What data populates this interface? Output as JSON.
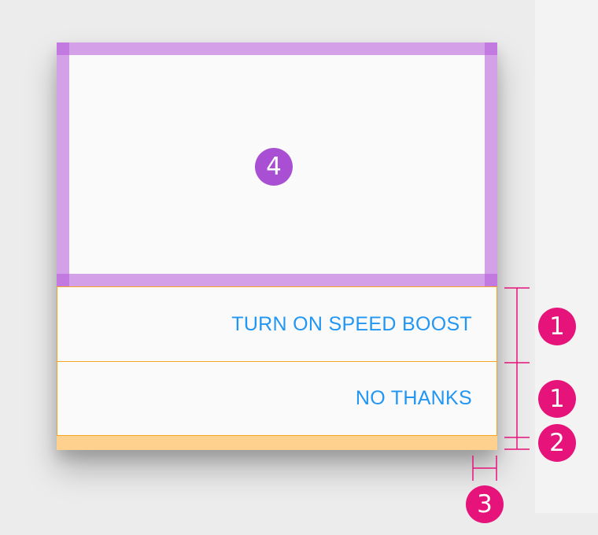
{
  "dialog": {
    "actions": [
      {
        "label": "TURN ON SPEED BOOST"
      },
      {
        "label": "NO THANKS"
      }
    ]
  },
  "callouts": {
    "content": "4",
    "button_height_first": "1",
    "button_height_second": "1",
    "bottom_padding": "2",
    "side_padding": "3"
  },
  "colors": {
    "background": "#ececec",
    "dialog_surface": "#fafafa",
    "button_text": "#2196f3",
    "padding_purple": "#d4a0e8",
    "button_outline": "#f5a623",
    "bottom_padding": "#ffd18f",
    "callout_pink": "#e6137a",
    "callout_purple": "#a84fd3"
  }
}
